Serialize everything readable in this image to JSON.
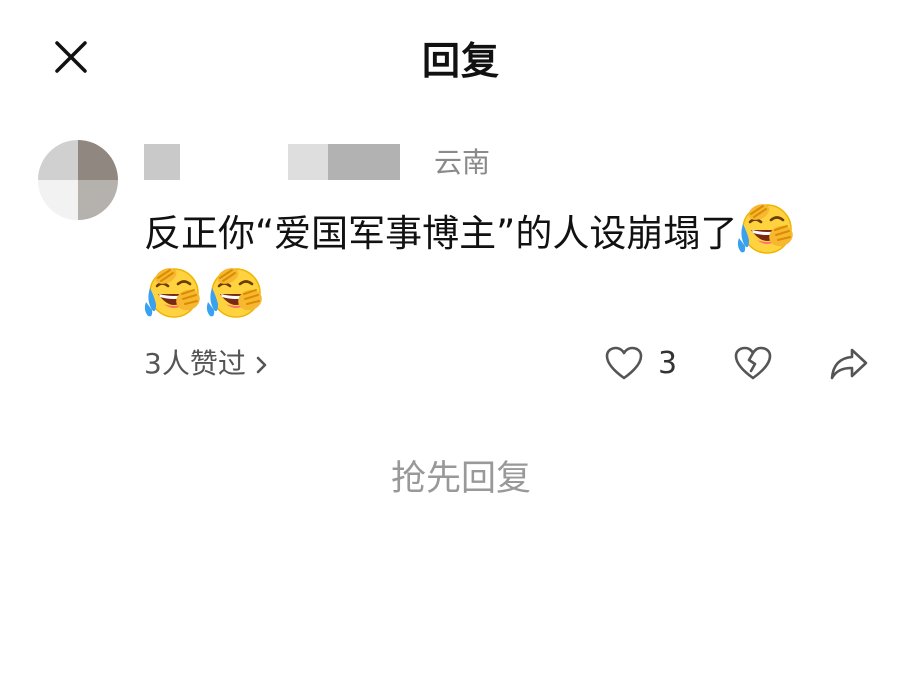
{
  "header": {
    "title": "回复",
    "close_icon": "close-icon"
  },
  "comment": {
    "location": "云南",
    "text": "反正你“爱国军事博主”的人设崩塌了",
    "emoji_name": "face-with-tears-of-joy-covering-eyes-emoji",
    "trailing_emoji_count": 3,
    "likes_summary": "3人赞过",
    "like_count": "3",
    "icons": {
      "like": "heart-icon",
      "dislike": "broken-heart-icon",
      "share": "share-icon",
      "chevron": "chevron-right-icon"
    }
  },
  "reply_prompt": "抢先回复",
  "colors": {
    "text_primary": "#111111",
    "text_secondary": "#8a8a8a",
    "prompt": "#999999",
    "icon": "#555555"
  }
}
